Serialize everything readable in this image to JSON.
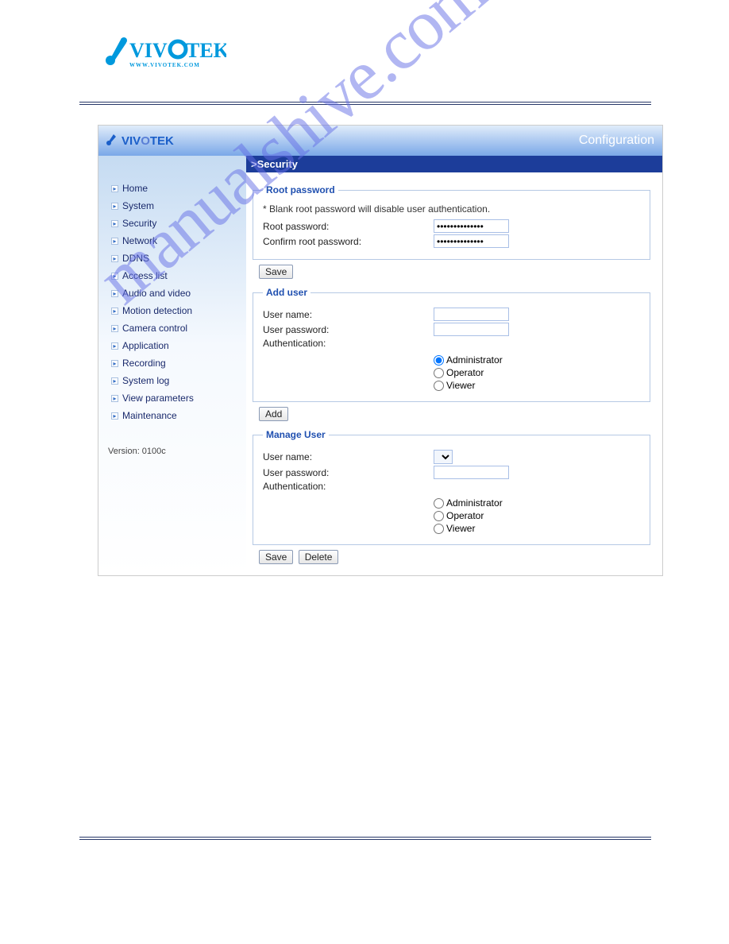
{
  "page_header": {
    "brand": "VIVOTEK",
    "brand_url_line": "WWW.VIVOTEK.COM"
  },
  "watermark": "manualshive.com",
  "app": {
    "brand_text": "VIVOTEK",
    "config_label": "Configuration"
  },
  "sidebar": {
    "items": [
      "Home",
      "System",
      "Security",
      "Network",
      "DDNS",
      "Access list",
      "Audio and video",
      "Motion detection",
      "Camera control",
      "Application",
      "Recording",
      "System log",
      "View parameters",
      "Maintenance"
    ],
    "version_label": "Version: 0100c"
  },
  "main": {
    "section_title": ">Security",
    "root_password": {
      "legend": "Root password",
      "note": "* Blank root password will disable user authentication.",
      "pw_label": "Root password:",
      "pw_value": "••••••••••••••",
      "confirm_label": "Confirm root password:",
      "confirm_value": "••••••••••••••",
      "save_btn": "Save"
    },
    "add_user": {
      "legend": "Add user",
      "username_label": "User name:",
      "username_value": "",
      "password_label": "User password:",
      "password_value": "",
      "auth_label": "Authentication:",
      "roles": {
        "admin": "Administrator",
        "operator": "Operator",
        "viewer": "Viewer"
      },
      "selected_role": "admin",
      "add_btn": "Add"
    },
    "manage_user": {
      "legend": "Manage User",
      "username_label": "User name:",
      "password_label": "User password:",
      "password_value": "",
      "auth_label": "Authentication:",
      "roles": {
        "admin": "Administrator",
        "operator": "Operator",
        "viewer": "Viewer"
      },
      "save_btn": "Save",
      "delete_btn": "Delete"
    }
  }
}
